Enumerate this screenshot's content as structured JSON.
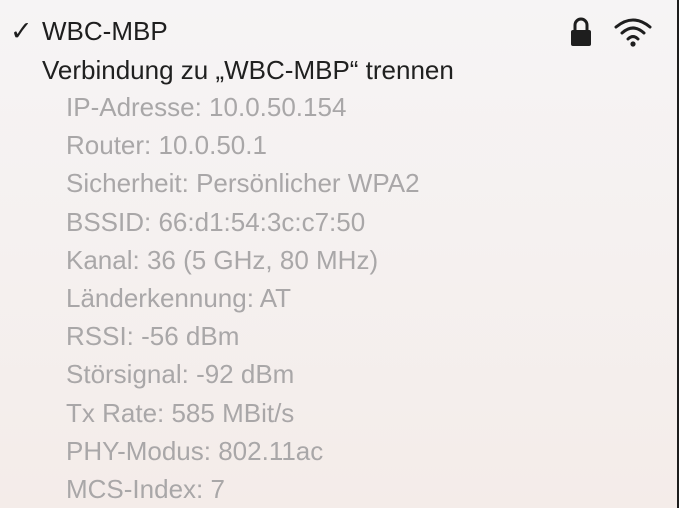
{
  "network": {
    "checkmark": "✓",
    "name": "WBC-MBP",
    "disconnect_label": "Verbindung zu „WBC-MBP“ trennen",
    "icons": [
      "lock-icon",
      "wifi-icon"
    ]
  },
  "details": [
    "IP-Adresse: 10.0.50.154",
    "Router: 10.0.50.1",
    "Sicherheit: Persönlicher WPA2",
    "BSSID: 66:d1:54:3c:c7:50",
    "Kanal: 36 (5 GHz, 80 MHz)",
    "Länderkennung: AT",
    "RSSI: -56 dBm",
    "Störsignal: -92 dBm",
    "Tx Rate: 585 MBit/s",
    "PHY-Modus: 802.11ac",
    "MCS-Index: 7"
  ],
  "colors": {
    "primary_text": "#1e1e1e",
    "secondary_text": "#a9a7a8",
    "background": "#f5f1f0"
  }
}
